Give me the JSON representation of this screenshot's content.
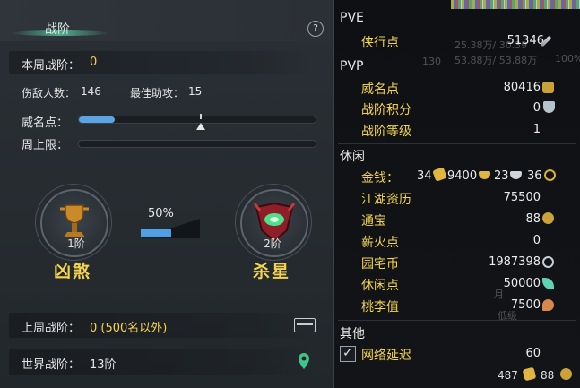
{
  "left_panel": {
    "title": "战阶",
    "help_label": "?",
    "weekly_label": "本周战阶：",
    "weekly_value": "0",
    "kills_label": "伤敌人数：",
    "kills_value": "146",
    "assists_label": "最佳助攻：",
    "assists_value": "15",
    "prestige_label": "威名点：",
    "prestige_fill": 0.15,
    "weekly_cap_label": "周上限：",
    "rank_current_level": "1阶",
    "rank_current_name": "凶煞",
    "progress_percent": "50%",
    "rank_next_level": "2阶",
    "rank_next_name": "杀星",
    "last_week_label": "上周战阶：",
    "last_week_value": "0 (500名以外)",
    "world_label": "世界战阶：",
    "world_value": "13阶"
  },
  "right_panel": {
    "pve": {
      "title": "PVE",
      "items": [
        {
          "label": "侠行点",
          "value": "51346",
          "icon": "sword-icon"
        }
      ]
    },
    "pvp": {
      "title": "PVP",
      "items": [
        {
          "label": "威名点",
          "value": "80416",
          "icon": "mask-icon"
        },
        {
          "label": "战阶积分",
          "value": "0",
          "icon": "shield-icon"
        },
        {
          "label": "战阶等级",
          "value": "1"
        }
      ]
    },
    "leisure": {
      "title": "休闲",
      "money_label": "金钱：",
      "money_gold": "34",
      "money_silver": "9400",
      "money_copper1": "23",
      "money_copper2": "36",
      "items": [
        {
          "label": "江湖资历",
          "value": "75500"
        },
        {
          "label": "通宝",
          "value": "88",
          "icon": "coin-icon"
        },
        {
          "label": "薪火点",
          "value": "0"
        },
        {
          "label": "园宅币",
          "value": "1987398",
          "icon": "g-coin-icon"
        },
        {
          "label": "休闲点",
          "value": "50000",
          "icon": "leaf-icon"
        },
        {
          "label": "桃李值",
          "value": "7500",
          "icon": "peach-icon"
        }
      ]
    },
    "other": {
      "title": "其他",
      "latency_label": "网络延迟",
      "latency_value": "60"
    },
    "footer": {
      "count_a": "487",
      "count_b": "88"
    },
    "background_text": {
      "t1": "25.38万/ 30.39",
      "t2": "130",
      "t3": "53.88万/ 53.88万",
      "t4": "100%",
      "t5": "月",
      "t6": "低级"
    }
  },
  "colors": {
    "accent_yellow": "#f3d44e",
    "bar_blue": "#5aa3e4",
    "panel_bg": "#262b30"
  }
}
